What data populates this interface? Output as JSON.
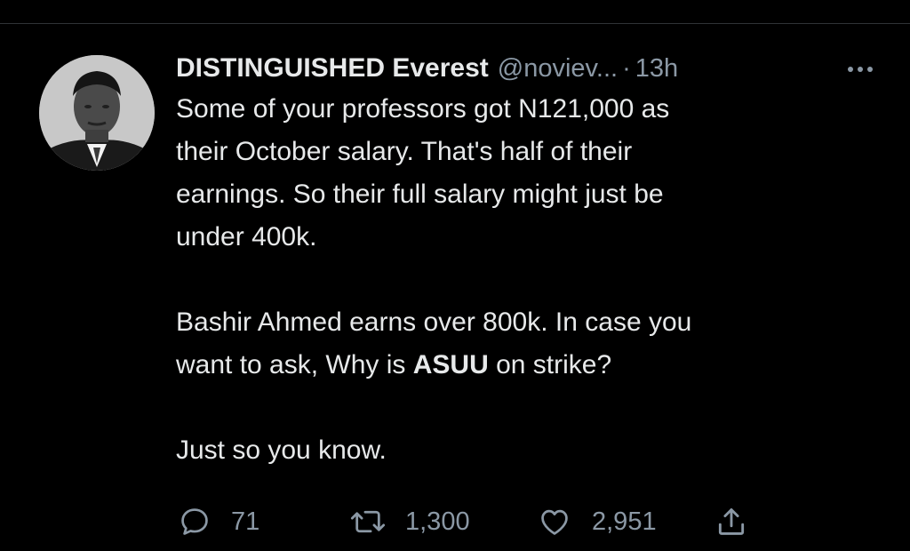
{
  "tweet": {
    "display_name": "DISTINGUISHED Everest",
    "handle": "@noviev...",
    "separator": "·",
    "time": "13h",
    "text": {
      "p1_line1": "Some of your professors got N121,000 as",
      "p1_line2": "their October salary. That's half of their",
      "p1_line3": "earnings. So their full salary might just be",
      "p1_line4": "under 400k.",
      "p2_line1": "Bashir Ahmed earns over 800k. In case you",
      "p2_line2_pre": "want to ask, Why is ",
      "p2_line2_bold": "ASUU",
      "p2_line2_post": " on strike?",
      "p3_line1": "Just so you know."
    }
  },
  "actions": {
    "replies": "71",
    "retweets": "1,300",
    "likes": "2,951"
  },
  "icons": {
    "reply": "reply-icon",
    "retweet": "retweet-icon",
    "like": "heart-icon",
    "share": "share-icon",
    "more": "more-icon"
  },
  "colors": {
    "background": "#000000",
    "text": "#e7e9ea",
    "muted": "#8b98a5"
  }
}
